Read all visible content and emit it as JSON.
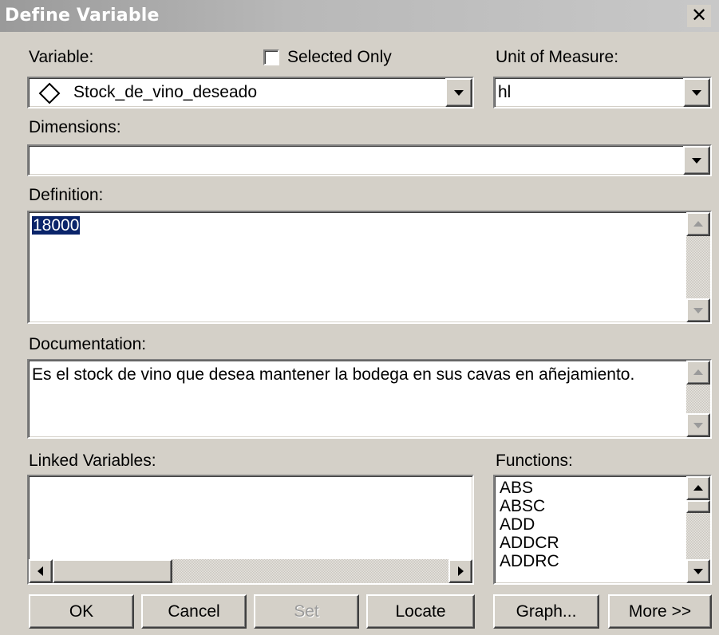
{
  "window": {
    "title": "Define Variable",
    "close_glyph": "✕",
    "close_icon": "close-icon"
  },
  "variable": {
    "label": "Variable:",
    "selected_only_label": "Selected Only",
    "selected_only_checked": false,
    "value": "Stock_de_vino_deseado",
    "type_icon": "diamond-icon"
  },
  "unit": {
    "label": "Unit of Measure:",
    "value": "hl"
  },
  "dimensions": {
    "label": "Dimensions:",
    "value": ""
  },
  "definition": {
    "label": "Definition:",
    "value": "18000"
  },
  "documentation": {
    "label": "Documentation:",
    "value": "Es el stock de vino que desea mantener la bodega en sus cavas en añejamiento."
  },
  "linked": {
    "label": "Linked Variables:",
    "items": []
  },
  "functions": {
    "label": "Functions:",
    "items": [
      "ABS",
      "ABSC",
      "ADD",
      "ADDCR",
      "ADDRC"
    ]
  },
  "buttons": {
    "ok": "OK",
    "cancel": "Cancel",
    "set": "Set",
    "locate": "Locate",
    "graph": "Graph...",
    "more": "More >>"
  },
  "colors": {
    "selection": "#0a246a",
    "face": "#d4d0c8"
  }
}
